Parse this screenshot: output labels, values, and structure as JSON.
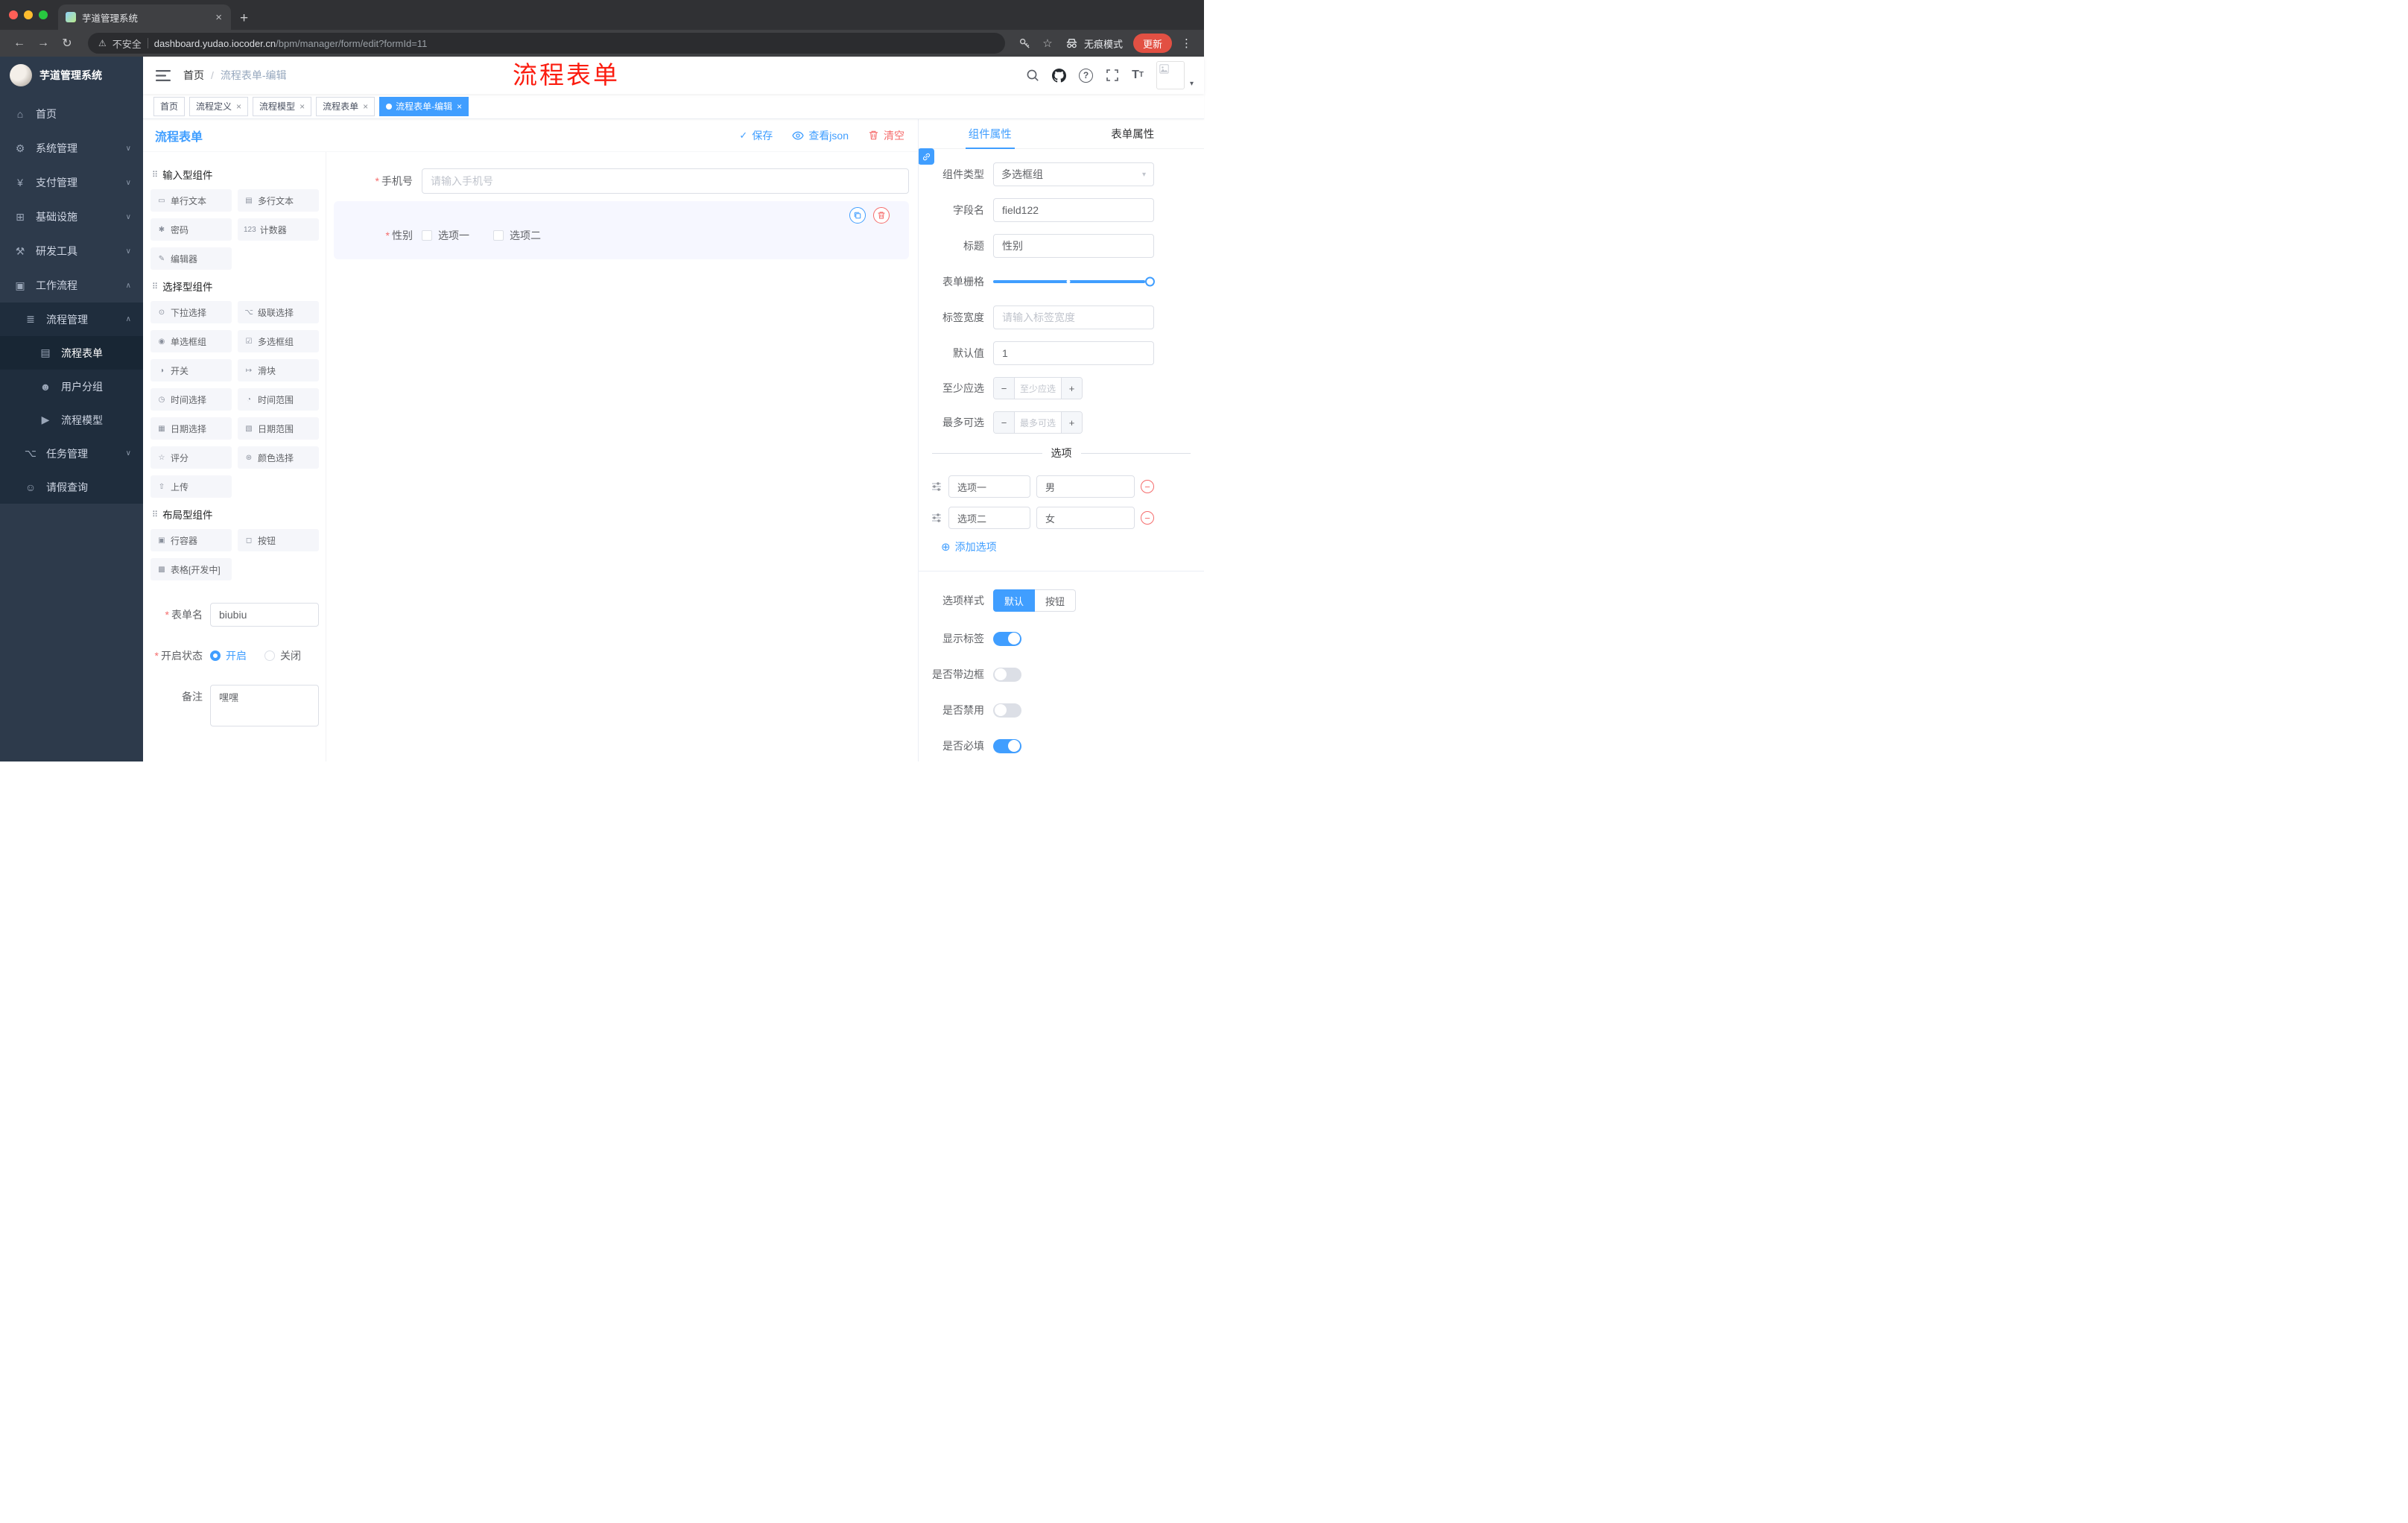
{
  "colors": {
    "accent": "#409eff",
    "danger": "#f56c6c",
    "annotation_red": "#fb1d10",
    "update_button": "#e25043",
    "active_tag": "#409eff"
  },
  "browser": {
    "tab_title": "芋道管理系统",
    "security_label": "不安全",
    "url_domain": "dashboard.yudao.iocoder.cn",
    "url_path": "/bpm/manager/form/edit?formId=11",
    "incognito_label": "无痕模式",
    "update_label": "更新"
  },
  "icons": {
    "close": "×",
    "new_tab": "+",
    "back": "←",
    "forward": "→",
    "reload": "↻",
    "warning": "⚠",
    "star": "☆",
    "dots": "⋮",
    "caret_down": "▾",
    "check": "✓",
    "breadcrumb_sep": "/",
    "asterisk": "*",
    "minus": "−",
    "plus": "+",
    "select_caret": "▾",
    "question": "?",
    "font_large": "T",
    "font_small": "T",
    "circle_plus": "⊕",
    "group_icon": "⠿"
  },
  "sidebar": {
    "logo_title": "芋道管理系统",
    "items": [
      {
        "label": "首页",
        "glyph": "⌂"
      },
      {
        "label": "系统管理",
        "glyph": "⚙",
        "arrow": "∨"
      },
      {
        "label": "支付管理",
        "glyph": "¥",
        "arrow": "∨"
      },
      {
        "label": "基础设施",
        "glyph": "⊞",
        "arrow": "∨"
      },
      {
        "label": "研发工具",
        "glyph": "⚒",
        "arrow": "∨"
      },
      {
        "label": "工作流程",
        "glyph": "▣",
        "arrow": "∧"
      },
      {
        "label": "流程管理",
        "glyph": "≣",
        "arrow": "∧"
      },
      {
        "label": "流程表单",
        "glyph": "▤",
        "active": true
      },
      {
        "label": "用户分组",
        "glyph": "☻"
      },
      {
        "label": "流程模型",
        "glyph": "▶"
      },
      {
        "label": "任务管理",
        "glyph": "⌥",
        "arrow": "∨"
      },
      {
        "label": "请假查询",
        "glyph": "☺"
      }
    ]
  },
  "header": {
    "breadcrumb": [
      "首页",
      "流程表单-编辑"
    ],
    "annotation": "流程表单"
  },
  "tags": [
    {
      "label": "首页",
      "closable": false,
      "active": false
    },
    {
      "label": "流程定义",
      "closable": true,
      "active": false
    },
    {
      "label": "流程模型",
      "closable": true,
      "active": false
    },
    {
      "label": "流程表单",
      "closable": true,
      "active": false
    },
    {
      "label": "流程表单-编辑",
      "closable": true,
      "active": true
    }
  ],
  "designer": {
    "title": "流程表单",
    "actions": {
      "save": "保存",
      "view_json": "查看json",
      "clear": "清空"
    },
    "palette": {
      "groups": [
        {
          "title": "输入型组件",
          "items": [
            {
              "label": "单行文本",
              "glyph": "▭"
            },
            {
              "label": "多行文本",
              "glyph": "▤"
            },
            {
              "label": "密码",
              "glyph": "✱"
            },
            {
              "label": "计数器",
              "glyph": "123"
            },
            {
              "label": "编辑器",
              "glyph": "✎"
            }
          ]
        },
        {
          "title": "选择型组件",
          "items": [
            {
              "label": "下拉选择",
              "glyph": "⊙"
            },
            {
              "label": "级联选择",
              "glyph": "⌥"
            },
            {
              "label": "单选框组",
              "glyph": "◉"
            },
            {
              "label": "多选框组",
              "glyph": "☑"
            },
            {
              "label": "开关",
              "glyph": "◑"
            },
            {
              "label": "滑块",
              "glyph": "↦"
            },
            {
              "label": "时间选择",
              "glyph": "◷"
            },
            {
              "label": "时间范围",
              "glyph": "◔"
            },
            {
              "label": "日期选择",
              "glyph": "▦"
            },
            {
              "label": "日期范围",
              "glyph": "▧"
            },
            {
              "label": "评分",
              "glyph": "☆"
            },
            {
              "label": "颜色选择",
              "glyph": "⊛"
            },
            {
              "label": "上传",
              "glyph": "⇧"
            }
          ]
        },
        {
          "title": "布局型组件",
          "items": [
            {
              "label": "行容器",
              "glyph": "▣"
            },
            {
              "label": "按钮",
              "glyph": "◻"
            },
            {
              "label": "表格[开发中]",
              "glyph": "▩"
            }
          ]
        }
      ]
    },
    "meta": {
      "name_label": "表单名",
      "name_value": "biubiu",
      "status_label": "开启状态",
      "status_on": "开启",
      "status_off": "关闭",
      "status_selected": "开启",
      "remark_label": "备注",
      "remark_value": "嘿嘿"
    },
    "canvas": {
      "phone": {
        "label": "手机号",
        "required": true,
        "placeholder": "请输入手机号"
      },
      "gender": {
        "label": "性别",
        "required": true,
        "options": [
          {
            "label": "选项一"
          },
          {
            "label": "选项二"
          }
        ]
      }
    },
    "props": {
      "tabs": [
        {
          "label": "组件属性"
        },
        {
          "label": "表单属性"
        }
      ],
      "active_tab": "组件属性",
      "rows": [
        {
          "label": "组件类型",
          "value": "多选框组"
        },
        {
          "label": "字段名",
          "value": "field122"
        },
        {
          "label": "标题",
          "value": "性别"
        },
        {
          "label": "表单栅格"
        },
        {
          "label": "标签宽度",
          "placeholder": "请输入标签宽度"
        },
        {
          "label": "默认值",
          "value": "1"
        },
        {
          "label": "至少应选",
          "placeholder": "至少应选"
        },
        {
          "label": "最多可选",
          "placeholder": "最多可选"
        }
      ],
      "options_title": "选项",
      "options": [
        {
          "label": "选项一",
          "value": "男"
        },
        {
          "label": "选项二",
          "value": "女"
        }
      ],
      "add_option": "添加选项",
      "style_label": "选项样式",
      "style_options": [
        {
          "label": "默认",
          "active": true
        },
        {
          "label": "按钮",
          "active": false
        }
      ],
      "toggles": [
        {
          "label": "显示标签",
          "on": true
        },
        {
          "label": "是否带边框",
          "on": false
        },
        {
          "label": "是否禁用",
          "on": false
        },
        {
          "label": "是否必填",
          "on": true
        }
      ]
    }
  }
}
